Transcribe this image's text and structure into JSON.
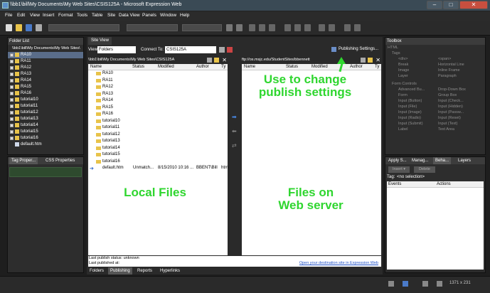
{
  "window": {
    "title": "\\\\bb1\\bill\\My Documents\\My Web Sites\\CSIS125A - Microsoft Expression Web",
    "min": "–",
    "max": "□",
    "close": "✕"
  },
  "menu": [
    "File",
    "Edit",
    "View",
    "Insert",
    "Format",
    "Tools",
    "Table",
    "Site",
    "Data View",
    "Panels",
    "Window",
    "Help"
  ],
  "folder_list": {
    "title": "Folder List",
    "path": "\\\\bb1\\bill\\My Documents\\My Web Sites\\",
    "items": [
      "RA10",
      "RA11",
      "RA12",
      "RA13",
      "RA14",
      "RA15",
      "RA16",
      "tutorial10",
      "tutorial11",
      "tutorial12",
      "tutorial13",
      "tutorial14",
      "tutorial15",
      "tutorial16",
      "default.htm"
    ]
  },
  "tag_props": {
    "tab1": "Tag Proper...",
    "tab2": "CSS Properties"
  },
  "site_view": {
    "tab": "Site View",
    "view_label": "View",
    "view_value": "Folders",
    "connect_label": "Connect To:",
    "connect_value": "CSIS125A",
    "publishing_settings": "Publishing Settings...",
    "local_path": "\\\\bb1\\bill\\My Documents\\My Web Sites\\CSIS125A",
    "remote_path": "ftp://os.msjc.edu/StudentSites/bbennett",
    "columns": {
      "name": "Name",
      "status": "Status",
      "modified": "Modified",
      "author": "Author",
      "type": "Ty"
    },
    "local_files": [
      "RA10",
      "RA11",
      "RA12",
      "RA13",
      "RA14",
      "RA15",
      "RA16",
      "tutorial10",
      "tutorial11",
      "tutorial12",
      "tutorial13",
      "tutorial14",
      "tutorial15",
      "tutorial16"
    ],
    "default_row": {
      "name": "default.htm",
      "status": "Unmatch...",
      "modified": "8/15/2010 10:16 ...",
      "author": "BBENT\\Bill",
      "type": "htm"
    },
    "last_status": "Last publish status: unknown",
    "last_published": "Last published at:",
    "open_link": "Open your destination site in Expression Web",
    "bottom_tabs": [
      "Folders",
      "Publishing",
      "Reports",
      "Hyperlinks"
    ]
  },
  "annotations": {
    "publish": "Use to change\npublish settings",
    "local": "Local Files",
    "server": "Files on\nWeb server"
  },
  "toolbox": {
    "title": "Toolbox",
    "html": "HTML",
    "tags": "Tags",
    "tags_items": [
      [
        "<div>",
        "<span>"
      ],
      [
        "Break",
        "Horizontal Line"
      ],
      [
        "Image",
        "Inline Frame"
      ],
      [
        "Layer",
        "Paragraph"
      ]
    ],
    "form": "Form Controls",
    "form_items": [
      [
        "Advanced Bu...",
        "Drop-Down Box"
      ],
      [
        "Form",
        "Group Box"
      ],
      [
        "Input (Button)",
        "Input (Check..."
      ],
      [
        "Input (File)",
        "Input (Hidden)"
      ],
      [
        "Input (Image)",
        "Input (Passw..."
      ],
      [
        "Input (Radio)",
        "Input (Reset)"
      ],
      [
        "Input (Submit)",
        "Input (Text)"
      ],
      [
        "Label",
        "Text Area"
      ]
    ]
  },
  "behaviors": {
    "tabs": [
      "Apply S...",
      "Manag...",
      "Beha...",
      "Layers"
    ],
    "insert": "Insert ▾",
    "delete": "Delete",
    "tag_label": "Tag:",
    "tag_value": "<no selection>",
    "col_events": "Events",
    "col_actions": "Actions"
  },
  "statusbar": {
    "size": "1371 x 231"
  }
}
